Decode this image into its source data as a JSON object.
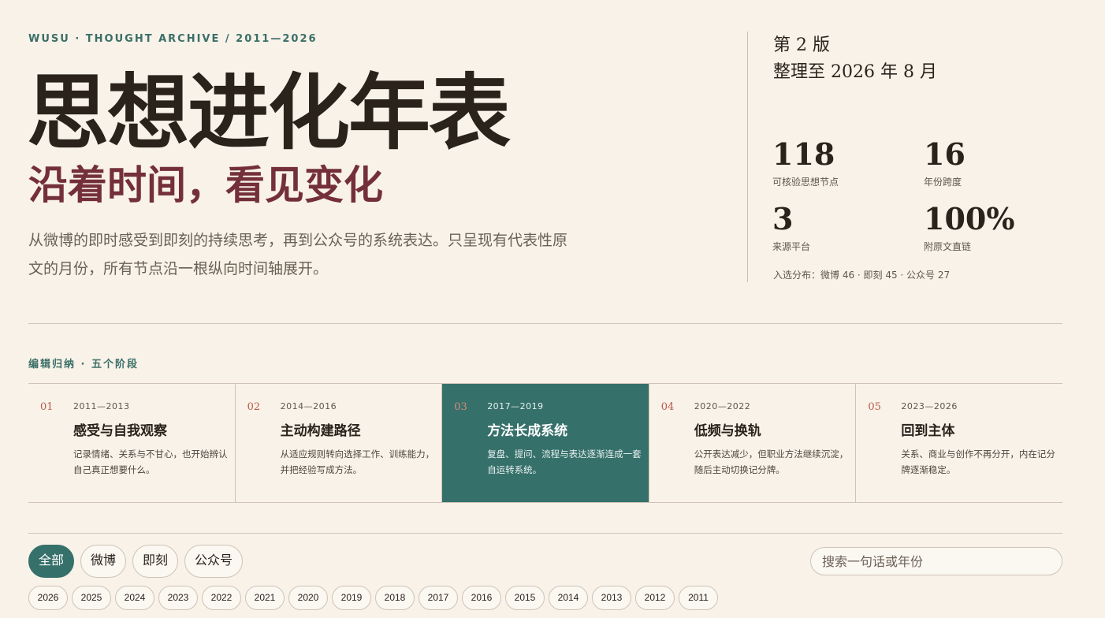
{
  "header": {
    "eyebrow": "WUSU · THOUGHT ARCHIVE / 2011—2026",
    "title": "思想进化年表",
    "subtitle": "沿着时间，看见变化",
    "intro": "从微博的即时感受到即刻的持续思考，再到公众号的系统表达。只呈现有代表性原文的月份，所有节点沿一根纵向时间轴展开。"
  },
  "meta": {
    "edition": "第 2 版",
    "updated": "整理至 2026 年 8 月",
    "stats": [
      {
        "value": "118",
        "label": "可核验思想节点"
      },
      {
        "value": "16",
        "label": "年份跨度"
      },
      {
        "value": "3",
        "label": "来源平台"
      },
      {
        "value": "100%",
        "label": "附原文直链"
      }
    ],
    "distribution": "入选分布：微博 46 · 即刻 45 · 公众号 27"
  },
  "stages": {
    "heading": "编辑归纳 · 五个阶段",
    "items": [
      {
        "index": "01",
        "years": "2011—2013",
        "name": "感受与自我观察",
        "desc": "记录情绪、关系与不甘心，也开始辨认自己真正想要什么。"
      },
      {
        "index": "02",
        "years": "2014—2016",
        "name": "主动构建路径",
        "desc": "从适应规则转向选择工作、训练能力，并把经验写成方法。"
      },
      {
        "index": "03",
        "years": "2017—2019",
        "name": "方法长成系统",
        "desc": "复盘、提问、流程与表达逐渐连成一套自运转系统。",
        "active": true
      },
      {
        "index": "04",
        "years": "2020—2022",
        "name": "低频与换轨",
        "desc": "公开表达减少，但职业方法继续沉淀，随后主动切换记分牌。"
      },
      {
        "index": "05",
        "years": "2023—2026",
        "name": "回到主体",
        "desc": "关系、商业与创作不再分开，内在记分牌逐渐稳定。"
      }
    ]
  },
  "filters": {
    "platforms": [
      "全部",
      "微博",
      "即刻",
      "公众号"
    ],
    "active_platform": "全部",
    "search_placeholder": "搜索一句话或年份",
    "years": [
      "2026",
      "2025",
      "2024",
      "2023",
      "2022",
      "2021",
      "2020",
      "2019",
      "2018",
      "2017",
      "2016",
      "2015",
      "2014",
      "2013",
      "2012",
      "2011"
    ]
  },
  "colors": {
    "background": "#f8f2e8",
    "accent_green": "#36706b",
    "accent_wine": "#74303a",
    "index_red": "#b85a4a"
  }
}
